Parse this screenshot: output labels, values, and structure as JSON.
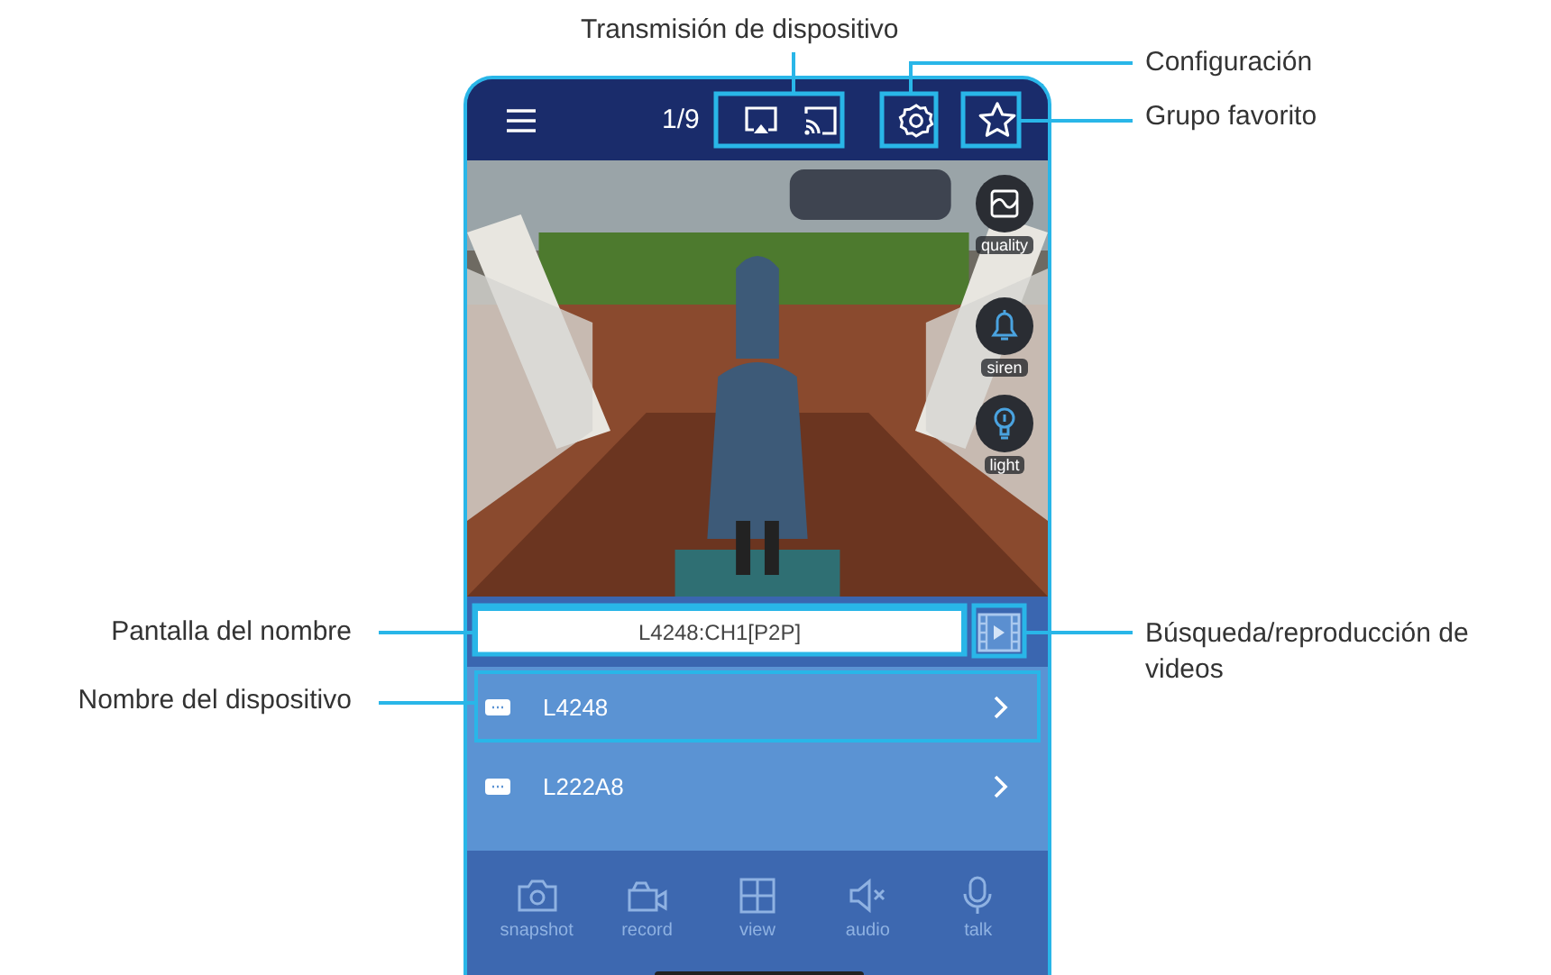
{
  "annotations": [
    {
      "label": "Transmisión de dispositivo"
    },
    {
      "label": "Configuración"
    },
    {
      "label": "Grupo favorito"
    },
    {
      "label": "Pantalla del nombre"
    },
    {
      "label": "Búsqueda/reproducción de videos"
    },
    {
      "label": "Nombre del dispositivo"
    }
  ],
  "header": {
    "counter": "1/9"
  },
  "video": {
    "overlay_buttons": [
      {
        "label": "quality"
      },
      {
        "label": "siren"
      },
      {
        "label": "light"
      }
    ]
  },
  "name_display": {
    "value": "L4248:CH1[P2P]"
  },
  "devices": [
    {
      "name": "L4248",
      "highlighted": true
    },
    {
      "name": "L222A8",
      "highlighted": false
    }
  ],
  "toolbar": [
    {
      "label": "snapshot"
    },
    {
      "label": "record"
    },
    {
      "label": "view"
    },
    {
      "label": "audio"
    },
    {
      "label": "talk"
    }
  ]
}
